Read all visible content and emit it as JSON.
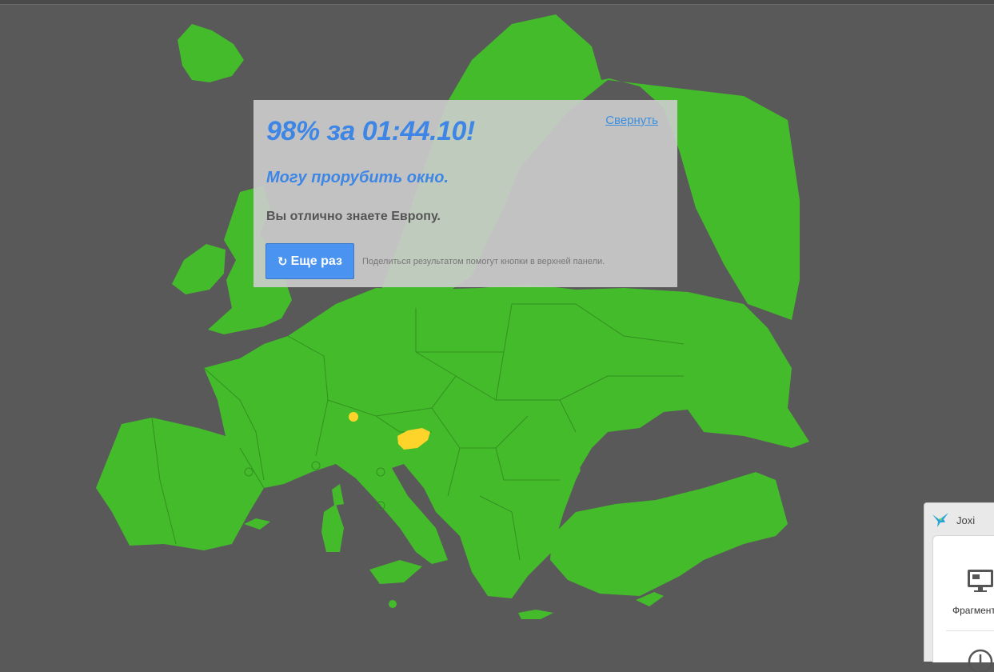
{
  "result": {
    "score_title": "98% за 01:44.10!",
    "subtitle": "Могу прорубить окно.",
    "message": "Вы отлично знаете Европу.",
    "collapse_label": "Свернуть",
    "retry_label": "Еще раз",
    "share_hint": "Поделиться результатом помогут кнопки в верхней панели."
  },
  "map": {
    "land_color": "#44bb2b",
    "highlight_color": "#ffd42a",
    "highlighted_country_icon": "slovenia-shape",
    "background_color": "#595959"
  },
  "joxi": {
    "name": "Joxi",
    "fragment_label": "Фрагмент",
    "logo_icon": "hummingbird-icon",
    "fragment_icon": "monitor-icon",
    "history_icon": "clock-icon"
  },
  "colors": {
    "accent": "#3d86e6",
    "button": "#4a93f0",
    "panel": "#cdcdcd"
  }
}
